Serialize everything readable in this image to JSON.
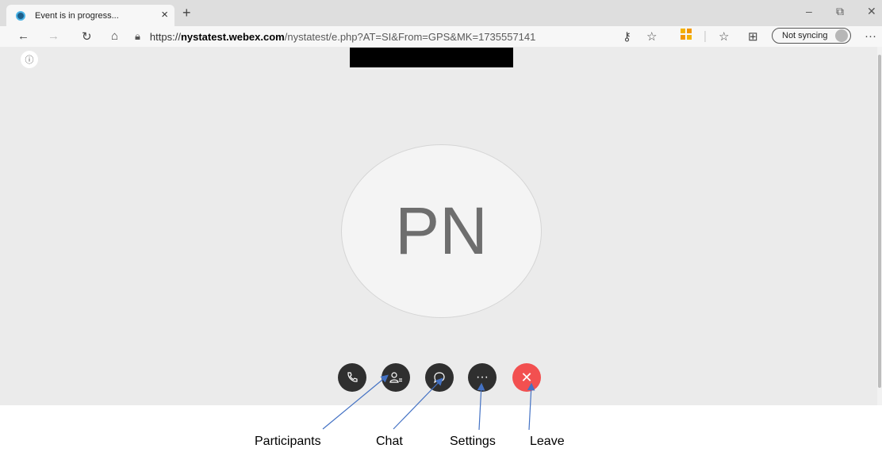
{
  "browser": {
    "tab_title": "Event is in progress...",
    "tab_close": "×",
    "new_tab": "+",
    "url_scheme": "https://",
    "url_domain": "nystatest.webex.com",
    "url_path": "/nystatest/e.php?AT=SI&From=GPS&MK=1735557141",
    "sync_label": "Not syncing",
    "more_label": "···",
    "window_controls": {
      "minimize": "–",
      "restore": "⧉",
      "close": "✕"
    }
  },
  "meeting": {
    "avatar_initials": "PN",
    "info_icon": "ⓘ",
    "controls": [
      {
        "name": "audio",
        "icon": "phone-icon"
      },
      {
        "name": "participants",
        "icon": "participants-icon"
      },
      {
        "name": "chat",
        "icon": "chat-bubble-icon"
      },
      {
        "name": "more",
        "icon": "more-icon",
        "glyph": "···"
      },
      {
        "name": "leave",
        "icon": "close-icon",
        "glyph": "✕"
      }
    ],
    "leave_color": "#f25050"
  },
  "annotations": {
    "participants": "Participants",
    "chat": "Chat",
    "settings": "Settings",
    "leave": "Leave"
  }
}
